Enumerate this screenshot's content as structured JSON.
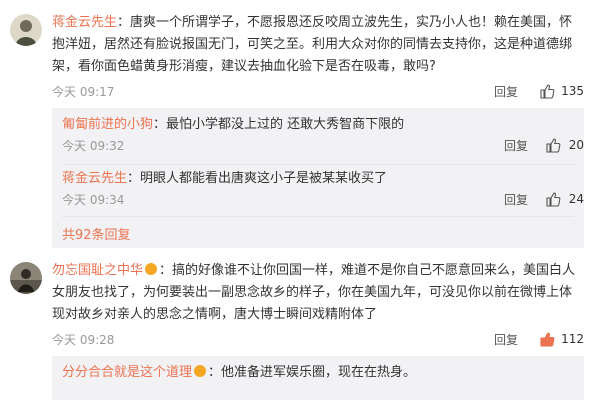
{
  "comments": [
    {
      "user": "蒋金云先生",
      "text": "：唐爽一个所谓学子，不愿报恩还反咬周立波先生，实乃小人也！赖在美国，怀抱洋妞，居然还有脸说报国无门，可笑之至。利用大众对你的同情去支持你，这是种道德绑架，看你面色蜡黄身形消瘦，建议去抽血化验下是否在吸毒，敢吗?",
      "time": "今天 09:17",
      "reply": "回复",
      "likes": "135",
      "replies": [
        {
          "user": "匍匐前进的小狗",
          "text": "：最怕小学都没上过的 还敢大秀智商下限的",
          "time": "今天 09:32",
          "reply": "回复",
          "likes": "20"
        },
        {
          "user": "蒋金云先生",
          "text": "：明眼人都能看出唐爽这小子是被某某收买了",
          "time": "今天 09:34",
          "reply": "回复",
          "likes": "24"
        }
      ],
      "more_replies": "共92条回复"
    },
    {
      "user": "勿忘国耻之中华",
      "text": "：搞的好像谁不让你回国一样，难道不是你自己不愿意回来么，美国白人女朋友也找了，为何要装出一副思念故乡的样子，你在美国九年，可没见你以前在微博上体现对故乡对亲人的思念之情啊，唐大博士瞬间戏精附体了",
      "time": "今天 09:28",
      "reply": "回复",
      "likes": "112",
      "replies": [
        {
          "user": "分分合合就是这个道理",
          "text": "：他准备进军娱乐圈，现在在热身。",
          "time": "",
          "reply": "",
          "likes": ""
        }
      ]
    }
  ],
  "colors": {
    "username": "#eb7350",
    "subbg": "#f2f2f5",
    "like_active": "#eb7350"
  },
  "icons": {
    "like": "thumbs-up-icon"
  }
}
